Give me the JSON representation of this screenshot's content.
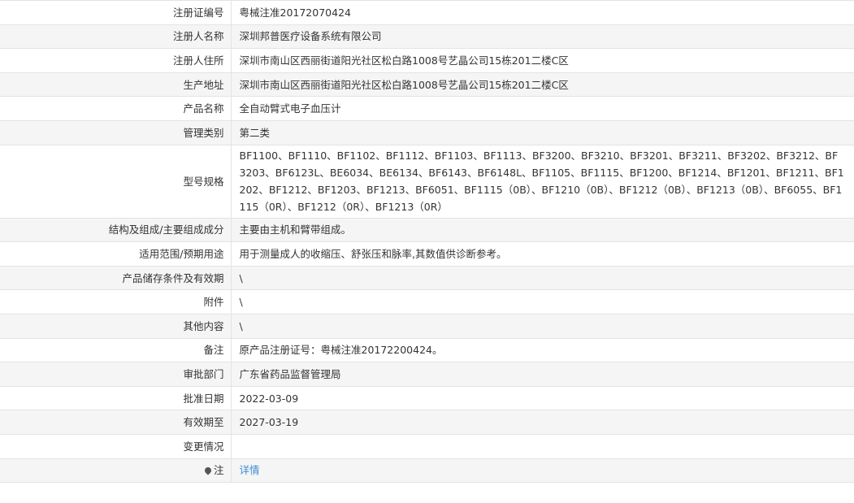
{
  "rows": [
    {
      "label": "注册证编号",
      "value": "粤械注准20172070424"
    },
    {
      "label": "注册人名称",
      "value": "深圳邦普医疗设备系统有限公司"
    },
    {
      "label": "注册人住所",
      "value": "深圳市南山区西丽街道阳光社区松白路1008号艺晶公司15栋201二楼C区"
    },
    {
      "label": "生产地址",
      "value": "深圳市南山区西丽街道阳光社区松白路1008号艺晶公司15栋201二楼C区"
    },
    {
      "label": "产品名称",
      "value": "全自动臂式电子血压计"
    },
    {
      "label": "管理类别",
      "value": "第二类"
    },
    {
      "label": "型号规格",
      "value": "BF1100、BF1110、BF1102、BF1112、BF1103、BF1113、BF3200、BF3210、BF3201、BF3211、BF3202、BF3212、BF3203、BF6123L、BE6034、BE6134、BF6143、BF6148L、BF1105、BF1115、BF1200、BF1214、BF1201、BF1211、BF1202、BF1212、BF1203、BF1213、BF6051、BF1115（0B）、BF1210（0B）、BF1212（0B）、BF1213（0B）、BF6055、BF1115（0R）、BF1212（0R）、BF1213（0R）"
    },
    {
      "label": "结构及组成/主要组成成分",
      "value": "主要由主机和臂带组成。"
    },
    {
      "label": "适用范围/预期用途",
      "value": "用于测量成人的收缩压、舒张压和脉率,其数值供诊断参考。"
    },
    {
      "label": "产品储存条件及有效期",
      "value": "\\"
    },
    {
      "label": "附件",
      "value": "\\"
    },
    {
      "label": "其他内容",
      "value": "\\"
    },
    {
      "label": "备注",
      "value": "原产品注册证号：粤械注准20172200424。"
    },
    {
      "label": "审批部门",
      "value": "广东省药品监督管理局"
    },
    {
      "label": "批准日期",
      "value": "2022-03-09"
    },
    {
      "label": "有效期至",
      "value": "2027-03-19"
    },
    {
      "label": "变更情况",
      "value": ""
    },
    {
      "label": "注",
      "value": "详情"
    }
  ],
  "icons": {
    "note_icon": "map-pin-icon"
  },
  "colors": {
    "link": "#3a8fd6",
    "row_alt": "#f5f5f5",
    "border": "#e3e3e3"
  }
}
